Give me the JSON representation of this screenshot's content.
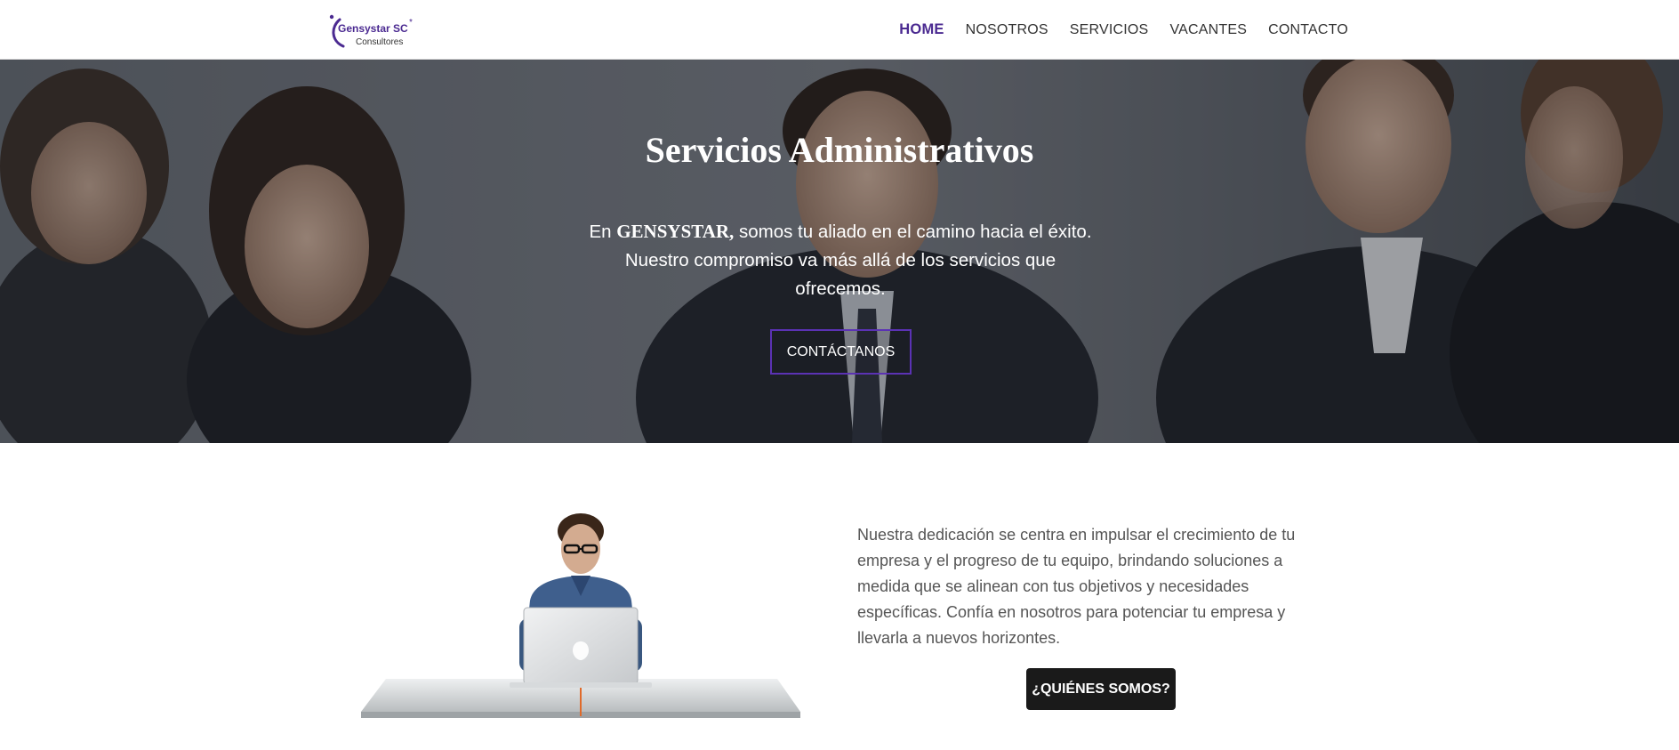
{
  "header": {
    "logo": {
      "name": "Gensystar SC",
      "subtitle": "Consultores"
    },
    "nav": [
      {
        "label": "HOME",
        "active": true
      },
      {
        "label": "NOSOTROS",
        "active": false
      },
      {
        "label": "SERVICIOS",
        "active": false
      },
      {
        "label": "VACANTES",
        "active": false
      },
      {
        "label": "CONTACTO",
        "active": false
      }
    ]
  },
  "hero": {
    "title": "Servicios Administrativos",
    "text_prefix": "En ",
    "text_brand": "GENSYSTAR,",
    "text_suffix": " somos tu aliado en el camino hacia el éxito. Nuestro compromiso va más allá de los servicios que ofrecemos.",
    "button_label": "CONTÁCTANOS"
  },
  "about": {
    "text": "Nuestra dedicación se centra en impulsar el crecimiento de tu empresa y el progreso de tu equipo, brindando soluciones a medida que se alinean con tus objetivos y necesidades específicas. Confía en nosotros para potenciar tu empresa y llevarla a nuevos horizontes.",
    "button_label": "¿QUIÉNES SOMOS?"
  },
  "colors": {
    "brand_purple": "#4b2a91",
    "button_border": "#5b32b4",
    "dark_button": "#1a1a1a"
  }
}
